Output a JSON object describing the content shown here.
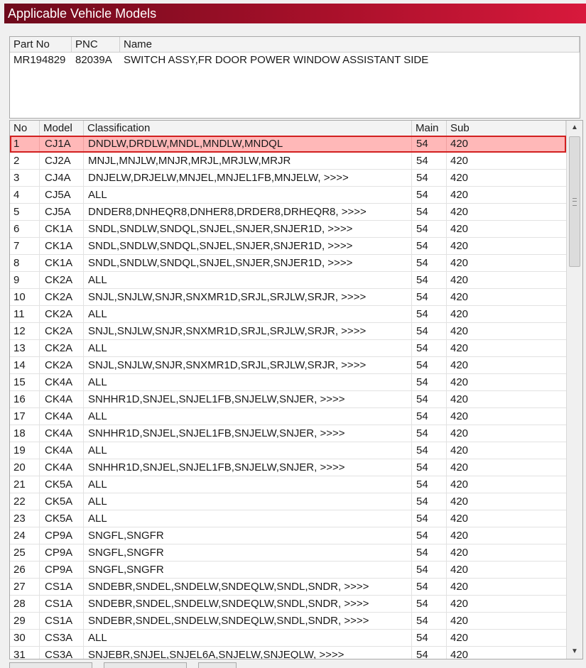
{
  "window": {
    "title": "Applicable Vehicle Models"
  },
  "part_table": {
    "columns": [
      "Part No",
      "PNC",
      "Name"
    ],
    "rows": [
      {
        "part_no": "MR194829",
        "pnc": "82039A",
        "name": "SWITCH ASSY,FR DOOR POWER WINDOW ASSISTANT SIDE"
      }
    ]
  },
  "model_table": {
    "columns": {
      "no": "No",
      "model": "Model",
      "classification": "Classification",
      "main": "Main",
      "sub": "Sub"
    },
    "selected_row": 1,
    "rows": [
      {
        "no": "1",
        "model": "CJ1A",
        "classification": "DNDLW,DRDLW,MNDL,MNDLW,MNDQL",
        "main": "54",
        "sub": "420"
      },
      {
        "no": "2",
        "model": "CJ2A",
        "classification": "MNJL,MNJLW,MNJR,MRJL,MRJLW,MRJR",
        "main": "54",
        "sub": "420"
      },
      {
        "no": "3",
        "model": "CJ4A",
        "classification": "DNJELW,DRJELW,MNJEL,MNJEL1FB,MNJELW,  >>>>",
        "main": "54",
        "sub": "420"
      },
      {
        "no": "4",
        "model": "CJ5A",
        "classification": "ALL",
        "main": "54",
        "sub": "420"
      },
      {
        "no": "5",
        "model": "CJ5A",
        "classification": "DNDER8,DNHEQR8,DNHER8,DRDER8,DRHEQR8,  >>>>",
        "main": "54",
        "sub": "420"
      },
      {
        "no": "6",
        "model": "CK1A",
        "classification": "SNDL,SNDLW,SNDQL,SNJEL,SNJER,SNJER1D,  >>>>",
        "main": "54",
        "sub": "420"
      },
      {
        "no": "7",
        "model": "CK1A",
        "classification": "SNDL,SNDLW,SNDQL,SNJEL,SNJER,SNJER1D,  >>>>",
        "main": "54",
        "sub": "420"
      },
      {
        "no": "8",
        "model": "CK1A",
        "classification": "SNDL,SNDLW,SNDQL,SNJEL,SNJER,SNJER1D,  >>>>",
        "main": "54",
        "sub": "420"
      },
      {
        "no": "9",
        "model": "CK2A",
        "classification": "ALL",
        "main": "54",
        "sub": "420"
      },
      {
        "no": "10",
        "model": "CK2A",
        "classification": "SNJL,SNJLW,SNJR,SNXMR1D,SRJL,SRJLW,SRJR,  >>>>",
        "main": "54",
        "sub": "420"
      },
      {
        "no": "11",
        "model": "CK2A",
        "classification": "ALL",
        "main": "54",
        "sub": "420"
      },
      {
        "no": "12",
        "model": "CK2A",
        "classification": "SNJL,SNJLW,SNJR,SNXMR1D,SRJL,SRJLW,SRJR,  >>>>",
        "main": "54",
        "sub": "420"
      },
      {
        "no": "13",
        "model": "CK2A",
        "classification": "ALL",
        "main": "54",
        "sub": "420"
      },
      {
        "no": "14",
        "model": "CK2A",
        "classification": "SNJL,SNJLW,SNJR,SNXMR1D,SRJL,SRJLW,SRJR,  >>>>",
        "main": "54",
        "sub": "420"
      },
      {
        "no": "15",
        "model": "CK4A",
        "classification": "ALL",
        "main": "54",
        "sub": "420"
      },
      {
        "no": "16",
        "model": "CK4A",
        "classification": "SNHHR1D,SNJEL,SNJEL1FB,SNJELW,SNJER,  >>>>",
        "main": "54",
        "sub": "420"
      },
      {
        "no": "17",
        "model": "CK4A",
        "classification": "ALL",
        "main": "54",
        "sub": "420"
      },
      {
        "no": "18",
        "model": "CK4A",
        "classification": "SNHHR1D,SNJEL,SNJEL1FB,SNJELW,SNJER,  >>>>",
        "main": "54",
        "sub": "420"
      },
      {
        "no": "19",
        "model": "CK4A",
        "classification": "ALL",
        "main": "54",
        "sub": "420"
      },
      {
        "no": "20",
        "model": "CK4A",
        "classification": "SNHHR1D,SNJEL,SNJEL1FB,SNJELW,SNJER,  >>>>",
        "main": "54",
        "sub": "420"
      },
      {
        "no": "21",
        "model": "CK5A",
        "classification": "ALL",
        "main": "54",
        "sub": "420"
      },
      {
        "no": "22",
        "model": "CK5A",
        "classification": "ALL",
        "main": "54",
        "sub": "420"
      },
      {
        "no": "23",
        "model": "CK5A",
        "classification": "ALL",
        "main": "54",
        "sub": "420"
      },
      {
        "no": "24",
        "model": "CP9A",
        "classification": "SNGFL,SNGFR",
        "main": "54",
        "sub": "420"
      },
      {
        "no": "25",
        "model": "CP9A",
        "classification": "SNGFL,SNGFR",
        "main": "54",
        "sub": "420"
      },
      {
        "no": "26",
        "model": "CP9A",
        "classification": "SNGFL,SNGFR",
        "main": "54",
        "sub": "420"
      },
      {
        "no": "27",
        "model": "CS1A",
        "classification": "SNDEBR,SNDEL,SNDELW,SNDEQLW,SNDL,SNDR,  >>>>",
        "main": "54",
        "sub": "420"
      },
      {
        "no": "28",
        "model": "CS1A",
        "classification": "SNDEBR,SNDEL,SNDELW,SNDEQLW,SNDL,SNDR,  >>>>",
        "main": "54",
        "sub": "420"
      },
      {
        "no": "29",
        "model": "CS1A",
        "classification": "SNDEBR,SNDEL,SNDELW,SNDEQLW,SNDL,SNDR,  >>>>",
        "main": "54",
        "sub": "420"
      },
      {
        "no": "30",
        "model": "CS3A",
        "classification": "ALL",
        "main": "54",
        "sub": "420"
      },
      {
        "no": "31",
        "model": "CS3A",
        "classification": "SNJEBR,SNJEL,SNJEL6A,SNJELW,SNJEQLW,  >>>>",
        "main": "54",
        "sub": "420"
      }
    ]
  },
  "scrollbar": {
    "up_icon": "arrow-up-icon",
    "down_icon": "arrow-down-icon"
  },
  "colors": {
    "title_dark": "#6e0a1c",
    "title_bright": "#d8193c",
    "selected_fill": "#ffb8b8",
    "selected_border": "#d22020"
  }
}
